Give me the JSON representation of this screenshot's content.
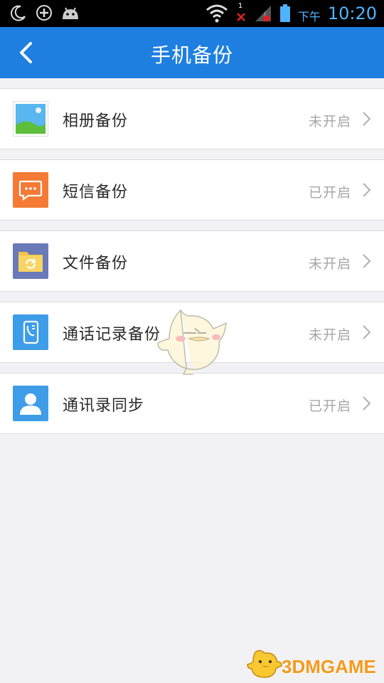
{
  "statusbar": {
    "ampm": "下午",
    "time": "10:20",
    "signal_badge": "1"
  },
  "header": {
    "title": "手机备份"
  },
  "items": [
    {
      "label": "相册备份",
      "status": "未开启",
      "icon": "photo-album-icon"
    },
    {
      "label": "短信备份",
      "status": "已开启",
      "icon": "sms-icon"
    },
    {
      "label": "文件备份",
      "status": "未开启",
      "icon": "folder-sync-icon"
    },
    {
      "label": "通话记录备份",
      "status": "未开启",
      "icon": "call-log-icon"
    },
    {
      "label": "通讯录同步",
      "status": "已开启",
      "icon": "contact-icon"
    }
  ],
  "watermark": {
    "text": "3DMGAME"
  },
  "colors": {
    "appbar": "#1e7fe0",
    "status_time": "#4fb3ff",
    "sms_icon_bg": "#f47a35",
    "folder_icon_bg": "#6a79b8",
    "call_icon_bg": "#3e9de8",
    "contact_icon_bg": "#3e9de8"
  }
}
